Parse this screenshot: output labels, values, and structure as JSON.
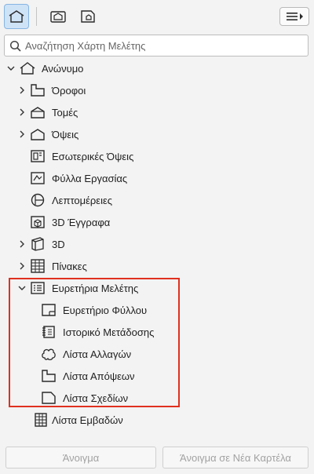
{
  "toolbar": {
    "icons": [
      "project-map-icon",
      "view-map-icon",
      "layout-book-icon"
    ],
    "menu_icon": "hamburger-menu-icon"
  },
  "search": {
    "placeholder": "Αναζήτηση Χάρτη Μελέτης"
  },
  "tree": {
    "root": {
      "label": "Ανώνυμο",
      "icon": "house-icon",
      "expanded": true
    },
    "items": [
      {
        "label": "Όροφοι",
        "icon": "story-icon",
        "expandable": true
      },
      {
        "label": "Τομές",
        "icon": "section-icon",
        "expandable": true
      },
      {
        "label": "Όψεις",
        "icon": "elevation-icon",
        "expandable": true
      },
      {
        "label": "Εσωτερικές Όψεις",
        "icon": "interior-elevation-icon",
        "expandable": false
      },
      {
        "label": "Φύλλα Εργασίας",
        "icon": "worksheet-icon",
        "expandable": false
      },
      {
        "label": "Λεπτομέρειες",
        "icon": "detail-icon",
        "expandable": false
      },
      {
        "label": "3D Έγγραφα",
        "icon": "3d-document-icon",
        "expandable": false
      },
      {
        "label": "3D",
        "icon": "3d-cube-icon",
        "expandable": true
      },
      {
        "label": "Πίνακες",
        "icon": "schedule-table-icon",
        "expandable": true
      },
      {
        "label": "Ευρετήρια Μελέτης",
        "icon": "project-index-icon",
        "expandable": true,
        "expanded": true
      },
      {
        "label": "Ευρετήριο Φύλλου",
        "icon": "sheet-index-icon"
      },
      {
        "label": "Ιστορικό Μετάδοσης",
        "icon": "transmittal-history-icon"
      },
      {
        "label": "Λίστα Αλλαγών",
        "icon": "change-list-icon"
      },
      {
        "label": "Λίστα Απόψεων",
        "icon": "view-list-icon"
      },
      {
        "label": "Λίστα Σχεδίων",
        "icon": "drawing-list-icon"
      },
      {
        "label": "Λίστα Εμβαδών",
        "icon": "area-list-icon"
      }
    ]
  },
  "footer": {
    "open_label": "Άνοιγμα",
    "open_new_tab_label": "Άνοιγμα σε Νέα Καρτέλα"
  },
  "colors": {
    "highlight": "#e0301e",
    "active_tab": "#cfe3f7"
  }
}
